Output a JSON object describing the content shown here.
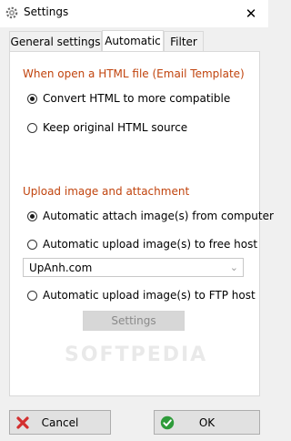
{
  "window": {
    "title": "Settings"
  },
  "tabs": [
    {
      "label": "General settings",
      "active": false
    },
    {
      "label": "Automatic",
      "active": true
    },
    {
      "label": "Filter",
      "active": false
    }
  ],
  "section_html": {
    "title": "When open a HTML file (Email Template)",
    "options": [
      {
        "label": "Convert HTML to more compatible",
        "checked": true
      },
      {
        "label": "Keep original HTML source",
        "checked": false
      }
    ]
  },
  "section_upload": {
    "title": "Upload image and attachment",
    "options": [
      {
        "label": "Automatic attach image(s) from computer",
        "checked": true
      },
      {
        "label": "Automatic upload image(s) to free host",
        "checked": false
      },
      {
        "label": "Automatic upload image(s) to FTP host",
        "checked": false
      }
    ],
    "free_host_selected": "UpAnh.com",
    "settings_label": "Settings"
  },
  "watermark": "SOFTPEDIA",
  "buttons": {
    "cancel_label": "Cancel",
    "ok_label": "OK"
  },
  "colors": {
    "section_title": "#c1440e",
    "cancel_icon": "#d32f2f",
    "ok_icon": "#2e9b3a"
  }
}
